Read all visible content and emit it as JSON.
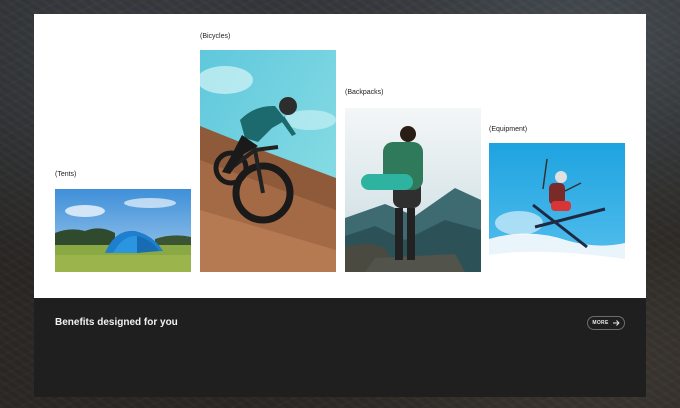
{
  "categories": [
    {
      "label": "(Tents)"
    },
    {
      "label": "(Bicycles)"
    },
    {
      "label": "(Backpacks)"
    },
    {
      "label": "(Equipment)"
    }
  ],
  "panel": {
    "title": "Benefits designed for you",
    "more_label": "MORE",
    "more_icon": "arrow-right-icon"
  },
  "colors": {
    "card_background": "#ffffff",
    "panel_background": "#1f1f1f"
  }
}
